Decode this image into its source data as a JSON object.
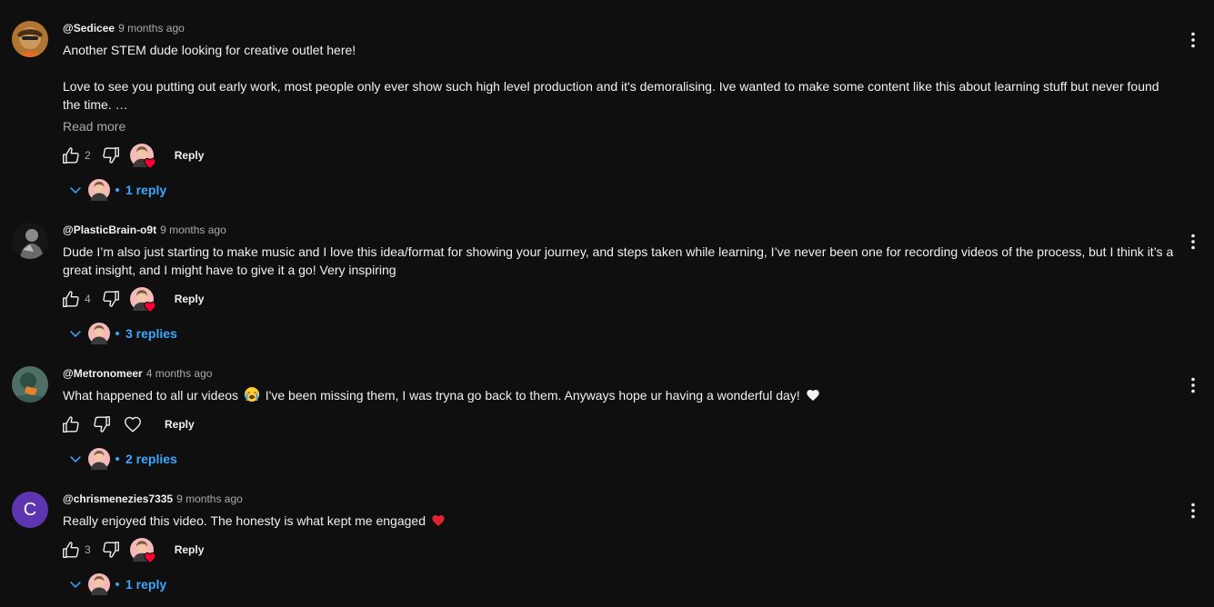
{
  "comments": [
    {
      "author": "@Sedicee",
      "time": "9 months ago",
      "paragraphs": [
        "Another STEM dude looking for creative outlet here!",
        "Love to see you putting out early work, most people only ever show such high level production and it's demoralising. Ive wanted to make some content like this about learning stuff but never found the time. …"
      ],
      "read_more": "Read more",
      "likes": "2",
      "reply_label": "Reply",
      "replies": "1 reply"
    },
    {
      "author": "@PlasticBrain-o9t",
      "time": "9 months ago",
      "text": "Dude I’m also just starting to make music and I love this idea/format for showing your journey, and steps taken while learning, I’ve never been one for recording videos of the process, but I think it’s a great insight, and I might have to give it a go! Very inspiring",
      "likes": "4",
      "reply_label": "Reply",
      "replies": "3 replies"
    },
    {
      "author": "@Metronomeer",
      "time": "4 months ago",
      "text_before_emoji": "What happened to all ur videos",
      "text_after_emoji": "I've been missing them, I was tryna go back to them. Anyways hope ur having a wonderful day!",
      "reply_label": "Reply",
      "replies": "2 replies"
    },
    {
      "author": "@chrismenezies7335",
      "avatar_letter": "C",
      "time": "9 months ago",
      "text": "Really enjoyed this video. The honesty is what kept me engaged",
      "likes": "3",
      "reply_label": "Reply",
      "replies": "1 reply"
    }
  ],
  "colors": {
    "background": "#0f0f0f",
    "text": "#f1f1f1",
    "secondary_text": "#aaaaaa",
    "link_blue": "#3ea6ff",
    "heart_red": "#ff0033",
    "letter_avatar": "#5e35b1"
  },
  "icons": [
    "thumbs-up-icon",
    "thumbs-down-icon",
    "heart-icon",
    "chevron-down-icon",
    "more-vert-icon",
    "loudly-crying-emoji",
    "white-heart-emoji",
    "red-heart-emoji"
  ]
}
